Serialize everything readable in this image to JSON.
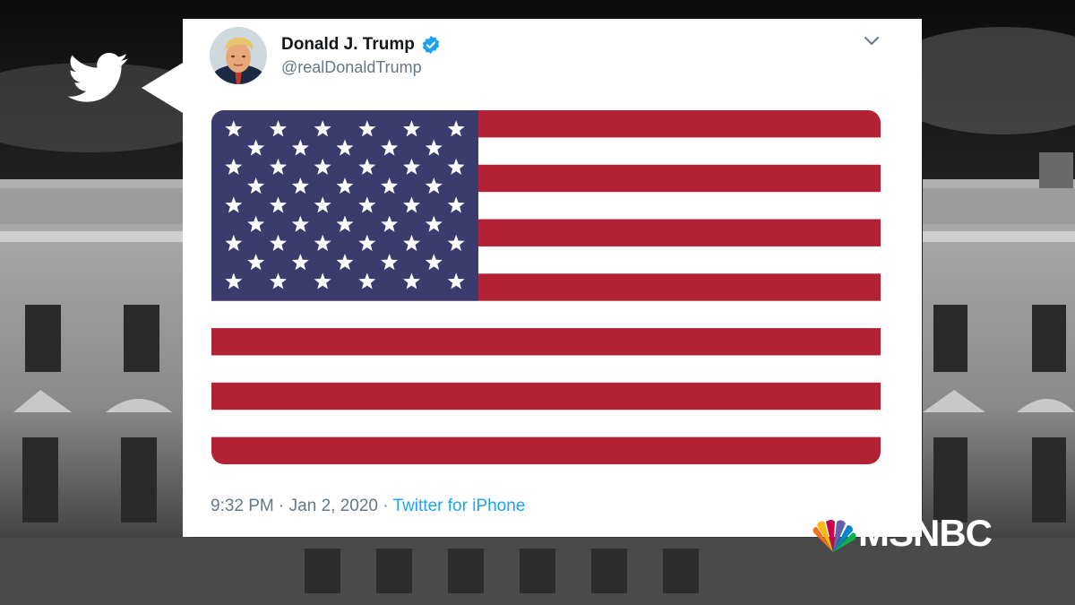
{
  "tweet": {
    "author_name": "Donald J. Trump",
    "handle": "@realDonaldTrump",
    "time": "9:32 PM",
    "sep1": " · ",
    "date": "Jan 2, 2020",
    "sep2": " · ",
    "source": "Twitter for iPhone"
  },
  "icons": {
    "bird": "twitter-bird-icon",
    "verified": "verified-badge-icon",
    "menu": "chevron-down-icon"
  },
  "broadcast": {
    "network_logo_text": "MSNBC"
  },
  "colors": {
    "twitter_blue": "#1da1f2",
    "flag_red": "#b22234",
    "flag_blue": "#3c3b6e",
    "card_bg": "#ffffff",
    "muted_text": "#657786"
  },
  "flag": {
    "stripes": 13,
    "star_rows": 9
  }
}
